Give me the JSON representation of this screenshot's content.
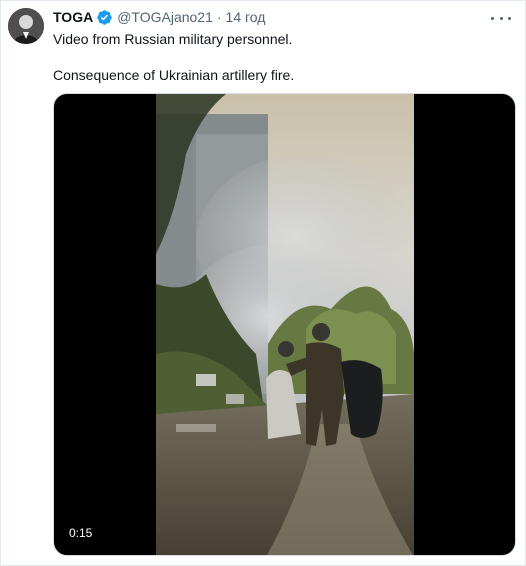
{
  "tweet": {
    "display_name": "TOGA",
    "handle": "@TOGAjano21",
    "separator": "·",
    "time": "14 год",
    "text_line_1": "Video from Russian military personnel.",
    "text_line_2": "Consequence of Ukrainian artillery fire.",
    "verified": true,
    "accent_color": "#1d9bf0"
  },
  "media": {
    "type": "video",
    "duration": "0:15"
  },
  "icons": {
    "verified": "verified-badge-icon",
    "more": "more-options-icon"
  }
}
